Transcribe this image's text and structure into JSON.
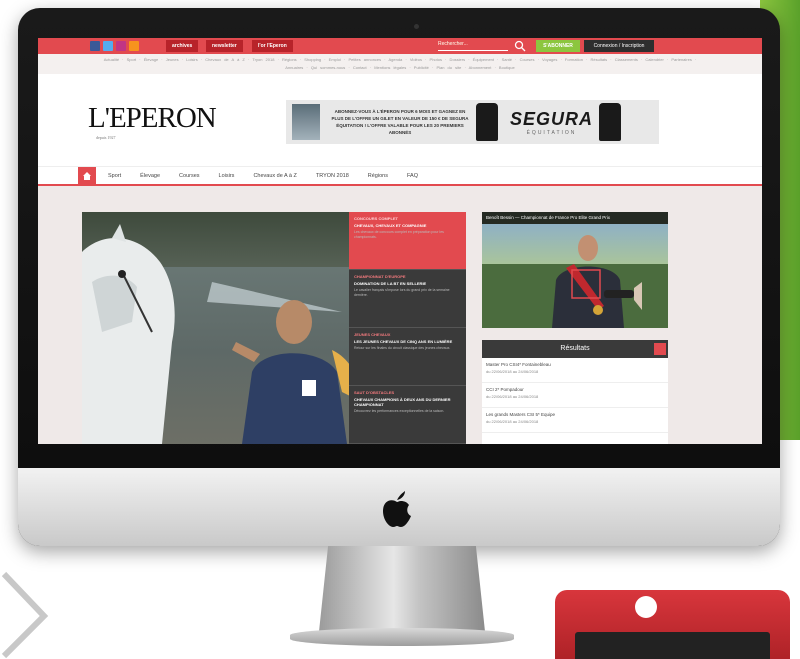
{
  "topbar": {
    "social_icons": [
      "facebook-icon",
      "twitter-icon",
      "instagram-icon",
      "rss-icon"
    ],
    "buttons": [
      "archives",
      "newsletter",
      "l'or l'Eperon"
    ],
    "search_placeholder": "Rechercher...",
    "subscribe_label": "S'ABONNER",
    "login_label": "Connexion / Inscription"
  },
  "sublinks": {
    "text": "Actualité · Sport · Élevage · Jeunes · Loisirs · Chevaux de A à Z · Tryon 2018 · Régions · Shopping · Emploi · Petites annonces · Agenda · Vidéos · Photos · Dossiers · Équipement · Santé · Courses · Voyages · Formation · Résultats · Classements · Calendrier · Partenaires · Annuaires · Qui sommes-nous · Contact · Mentions légales · Publicité · Plan du site · Abonnement · Boutique"
  },
  "header": {
    "logo": "L'EPERON",
    "logo_sub": "depuis 1927",
    "banner_text": "ABONNEZ-VOUS À L'ÉPERON POUR 6 MOIS ET GAGNEZ EN PLUS DE L'OFFRE UN GILET EN VALEUR DE 150 € DE SEGURA ÉQUITATION ! L'OFFRE VALABLE POUR LES 20 PREMIERS ABONNÉS",
    "banner_brand": "SEGURA",
    "banner_brand_sub": "ÉQUITATION"
  },
  "nav": {
    "items": [
      "Sport",
      "Élevage",
      "Courses",
      "Loisirs",
      "Chevaux de A à Z",
      "TRYON 2018",
      "Régions",
      "FAQ"
    ]
  },
  "stories": [
    {
      "category": "CONCOURS COMPLET",
      "headline": "CHEVAUX, CHEVAUX ET COMPAGNIE",
      "desc": "Les chevaux de concours complet en préparation pour les championnats."
    },
    {
      "category": "CHAMPIONNAT D'EUROPE",
      "headline": "DOMINATION DE LA BT EN SELLERIE",
      "desc": "Le cavalier français s'impose lors du grand prix de la semaine dernière."
    },
    {
      "category": "JEUNES CHEVAUX",
      "headline": "LES JEUNES CHEVAUX DE CINQ ANS EN LUMIÈRE",
      "desc": "Retour sur les finales du circuit classique des jeunes chevaux."
    },
    {
      "category": "SAUT D'OBSTACLES",
      "headline": "CHEVAUX CHAMPIONS À DEUX ANS DU DERNIER CHAMPIONNAT",
      "desc": "Découvrez les performances exceptionnelles de la saison."
    }
  ],
  "video": {
    "title": "Benoît Bessin — Championnat de France Pro Elite Grand Prix"
  },
  "results": {
    "title": "Résultats",
    "items": [
      {
        "title": "Master Pro CSI4* Fontainebleau",
        "date": "du 22/06/2018 au 24/06/2018"
      },
      {
        "title": "CCI 2* Pompadour",
        "date": "du 22/06/2018 au 24/06/2018"
      },
      {
        "title": "Les grands Masters CSI 5* Equipe",
        "date": "du 22/06/2018 au 24/06/2018"
      }
    ]
  },
  "colors": {
    "brand_red": "#e24a4f",
    "accent_green": "#8cc63f",
    "dark": "#3a3a3a"
  }
}
